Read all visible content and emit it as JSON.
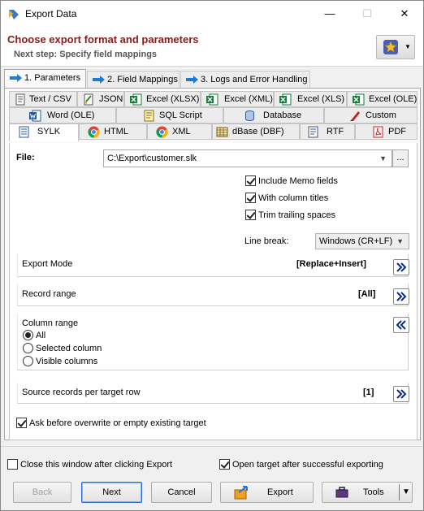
{
  "window": {
    "title": "Export Data",
    "minimize_glyph": "—",
    "maximize_glyph": "☐",
    "close_glyph": "✕"
  },
  "header": {
    "title": "Choose export format and parameters",
    "subtitle": "Next step: Specify field mappings",
    "favorites_icon": "star-icon",
    "favorites_dropdown_glyph": "▼"
  },
  "step_tabs": [
    {
      "label": "1. Parameters",
      "active": true
    },
    {
      "label": "2. Field Mappings",
      "active": false
    },
    {
      "label": "3. Logs and Error Handling",
      "active": false
    }
  ],
  "format_tabs": {
    "row1": [
      "Text / CSV",
      "JSON",
      "Excel (XLSX)",
      "Excel (XML)",
      "Excel (XLS)",
      "Excel (OLE)"
    ],
    "row2": [
      "Word (OLE)",
      "SQL Script",
      "Database",
      "Custom"
    ],
    "row3": [
      "SYLK",
      "HTML",
      "XML",
      "dBase (DBF)",
      "RTF",
      "PDF"
    ],
    "active": "SYLK"
  },
  "file": {
    "label": "File:",
    "value": "C:\\Export\\customer.slk",
    "browse_label": "..."
  },
  "options": {
    "include_memo": {
      "label": "Include Memo fields",
      "checked": true
    },
    "with_titles": {
      "label": "With column titles",
      "checked": true
    },
    "trim_spaces": {
      "label": "Trim trailing spaces",
      "checked": true
    }
  },
  "line_break": {
    "label": "Line break:",
    "value": "Windows (CR+LF)"
  },
  "groups": {
    "export_mode": {
      "label": "Export Mode",
      "value": "[Replace+Insert]"
    },
    "record_range": {
      "label": "Record range",
      "value": "[All]"
    },
    "column_range": {
      "label": "Column range",
      "options": [
        "All",
        "Selected column",
        "Visible columns"
      ],
      "selected": "All"
    },
    "source_records": {
      "label": "Source records per target row",
      "value": "[1]"
    }
  },
  "ask_overwrite": {
    "label": "Ask before overwrite or empty existing target",
    "checked": true
  },
  "footer": {
    "close_after": {
      "label": "Close this window after clicking Export",
      "checked": false
    },
    "open_target": {
      "label": "Open target after successful exporting",
      "checked": true
    },
    "buttons": {
      "back": "Back",
      "next": "Next",
      "cancel": "Cancel",
      "export": "Export",
      "tools": "Tools"
    }
  },
  "colors": {
    "title_red": "#8b1a1a",
    "arrow_blue": "#1e7ad8",
    "excel_green": "#1d7a3c",
    "pdf_red": "#d02020"
  }
}
